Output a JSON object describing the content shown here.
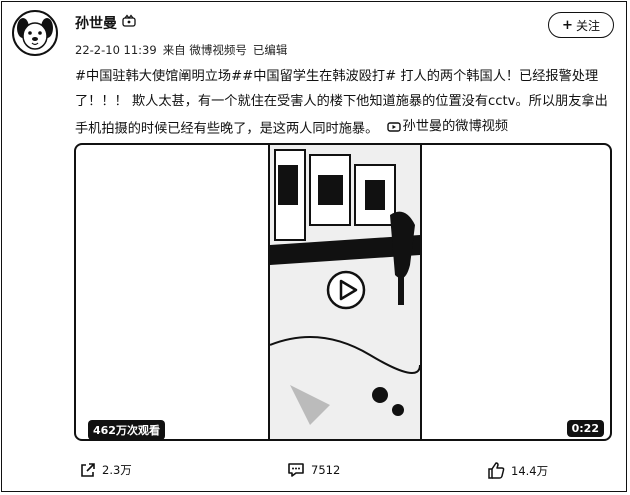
{
  "post": {
    "author": "孙世曼",
    "follow_label": "关注",
    "follow_plus": "+",
    "timestamp": "22-2-10 11:39",
    "source": "来自 微博视频号",
    "edited": "已编辑",
    "text_part1": "#中国驻韩大使馆阐明立场##中国留学生在韩波殴打# 打人的两个韩国人！已经报警处理了！！！ 欺人太甚，有一个就住在受害人的楼下他知道施暴的位置没有cctv。所以朋友拿出手机拍摄的时候已经有些晚了，是这两人同时施暴。",
    "video_link_label": "孙世曼的微博视频"
  },
  "video": {
    "views": "462万次观看",
    "duration": "0:22"
  },
  "actions": {
    "share_count": "2.3万",
    "comment_count": "7512",
    "like_count": "14.4万"
  }
}
